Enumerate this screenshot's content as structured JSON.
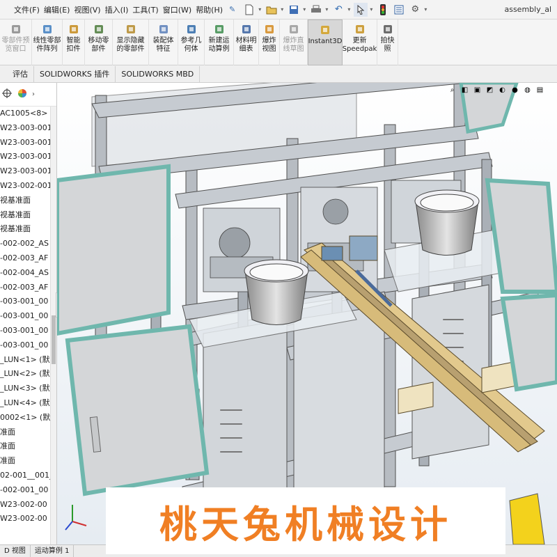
{
  "menu": [
    "文件(F)",
    "编辑(E)",
    "视图(V)",
    "插入(I)",
    "工具(T)",
    "窗口(W)",
    "帮助(H)"
  ],
  "document_title": "assembly_al",
  "ribbon": [
    {
      "label": "零部件预\n览窗口",
      "state": "disabled",
      "icon": "preview-window-icon",
      "color": "#8a8a8a"
    },
    {
      "label": "线性零部\n件阵列",
      "state": "normal",
      "icon": "linear-pattern-icon",
      "color": "#3f7ec0"
    },
    {
      "label": "智能\n扣件",
      "state": "normal",
      "icon": "smart-fastener-icon",
      "color": "#c48a1a"
    },
    {
      "label": "移动零\n部件",
      "state": "normal",
      "icon": "move-component-icon",
      "color": "#4a7a3a"
    },
    {
      "label": "显示隐藏\n的零部件",
      "state": "normal",
      "icon": "show-hidden-icon",
      "color": "#b48a2a"
    },
    {
      "label": "装配体\n特征",
      "state": "normal",
      "icon": "assembly-feature-icon",
      "color": "#5b7fb8"
    },
    {
      "label": "参考几\n何体",
      "state": "normal",
      "icon": "reference-geometry-icon",
      "color": "#2f6aa8"
    },
    {
      "label": "新建运\n动算例",
      "state": "normal",
      "icon": "motion-study-icon",
      "color": "#3c8c4c"
    },
    {
      "label": "材料明\n细表",
      "state": "normal",
      "icon": "bom-icon",
      "color": "#3a62a0"
    },
    {
      "label": "爆炸\n视图",
      "state": "normal",
      "icon": "explode-view-icon",
      "color": "#d48a1e"
    },
    {
      "label": "爆炸直\n线草图",
      "state": "disabled",
      "icon": "explode-line-icon",
      "color": "#9a9a9a"
    },
    {
      "label": "Instant3D",
      "state": "active",
      "icon": "instant3d-icon",
      "color": "#d4a020"
    },
    {
      "label": "更新\nSpeedpak",
      "state": "normal",
      "icon": "speedpak-icon",
      "color": "#c6901e"
    },
    {
      "label": "拍快\n照",
      "state": "normal",
      "icon": "snapshot-icon",
      "color": "#555555"
    }
  ],
  "tabs": [
    "评估",
    "SOLIDWORKS 插件",
    "SOLIDWORKS MBD"
  ],
  "tree": [
    "AC1005<8> (",
    "W23-003-001",
    "W23-003-001",
    "W23-003-001",
    "W23-003-001",
    "W23-002-001",
    "视基准面",
    "视基准面",
    "视基准面",
    "-002-002_AS",
    "-002-003_AF",
    "-002-004_AS",
    "-002-003_AF",
    "-003-001_00",
    "-003-001_00",
    "-003-001_00",
    "-003-001_00",
    "_LUN<1> (默",
    "_LUN<2> (默",
    "_LUN<3> (默",
    "_LUN<4> (默",
    "0002<1> (默",
    "准面",
    "准面",
    "准面",
    "02-001__001_/",
    "-002-001_00",
    "W23-002-00",
    "W23-002-00"
  ],
  "bottom_tabs": [
    "D 视图",
    "运动算例 1"
  ],
  "watermark": "桃天兔机械设计",
  "colors": {
    "accent": "#f07f24",
    "panel_teal": "#6fb7ad"
  }
}
